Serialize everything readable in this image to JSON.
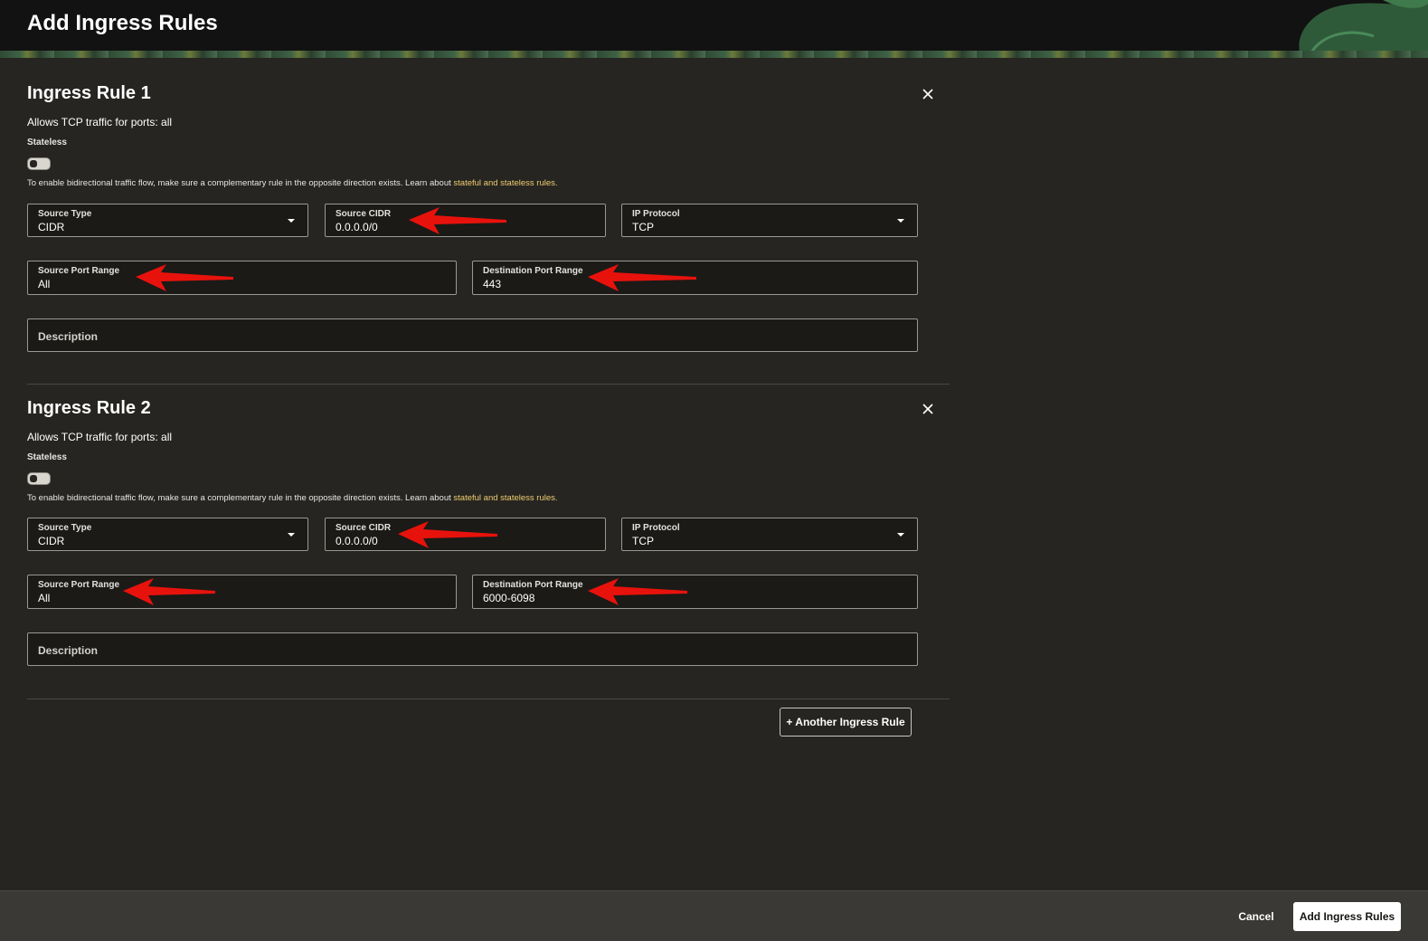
{
  "header": {
    "title": "Add Ingress Rules"
  },
  "rules": [
    {
      "title": "Ingress Rule 1",
      "summary": "Allows TCP traffic for ports: all",
      "stateless_label": "Stateless",
      "stateless_enabled": false,
      "help_text": "To enable bidirectional traffic flow, make sure a complementary rule in the opposite direction exists. Learn about ",
      "help_link": "stateful and stateless rules.",
      "source_type": {
        "label": "Source Type",
        "value": "CIDR"
      },
      "source_cidr": {
        "label": "Source CIDR",
        "value": "0.0.0.0/0"
      },
      "ip_protocol": {
        "label": "IP Protocol",
        "value": "TCP"
      },
      "source_port_range": {
        "label": "Source Port Range",
        "value": "All"
      },
      "destination_port_range": {
        "label": "Destination Port Range",
        "value": "443"
      },
      "description": {
        "placeholder": "Description"
      }
    },
    {
      "title": "Ingress Rule 2",
      "summary": "Allows TCP traffic for ports: all",
      "stateless_label": "Stateless",
      "stateless_enabled": false,
      "help_text": "To enable bidirectional traffic flow, make sure a complementary rule in the opposite direction exists. Learn about ",
      "help_link": "stateful and stateless rules.",
      "source_type": {
        "label": "Source Type",
        "value": "CIDR"
      },
      "source_cidr": {
        "label": "Source CIDR",
        "value": "0.0.0.0/0"
      },
      "ip_protocol": {
        "label": "IP Protocol",
        "value": "TCP"
      },
      "source_port_range": {
        "label": "Source Port Range",
        "value": "All"
      },
      "destination_port_range": {
        "label": "Destination Port Range",
        "value": "6000-6098"
      },
      "description": {
        "placeholder": "Description"
      }
    }
  ],
  "actions": {
    "another_rule_label": "+ Another Ingress Rule",
    "cancel_label": "Cancel",
    "submit_label": "Add Ingress Rules"
  },
  "icons": {
    "close": "close-icon",
    "dropdown": "chevron-down-icon",
    "annotation": "red-arrow-annotation"
  },
  "colors": {
    "background": "#262521",
    "header": "#121212",
    "link": "#f0cc71",
    "annotation_arrow": "#e8120c"
  }
}
